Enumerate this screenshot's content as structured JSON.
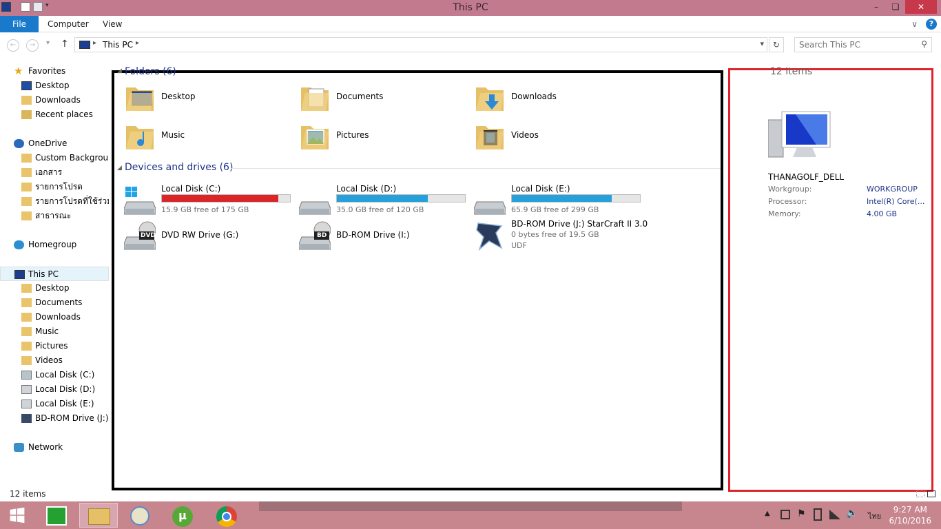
{
  "window": {
    "title": "This PC",
    "minimize": "–",
    "maximize": "❏",
    "close": "✕"
  },
  "ribbon": {
    "file": "File",
    "tabs": [
      "Computer",
      "View"
    ],
    "expand": "∨",
    "help": "?"
  },
  "address": {
    "back": "←",
    "forward": "→",
    "dropdown": "▾",
    "up": "↑",
    "path": "This PC",
    "path_arrow": "▸",
    "history": "▾",
    "refresh": "↻",
    "search_placeholder": "Search This PC",
    "search_icon": "⚲"
  },
  "nav": {
    "favorites": {
      "label": "Favorites",
      "items": [
        "Desktop",
        "Downloads",
        "Recent places"
      ]
    },
    "onedrive": {
      "label": "OneDrive",
      "items": [
        "Custom Backgroun",
        "เอกสาร",
        "รายการโปรด",
        "รายการโปรดที่ใช้ร่วมกัน",
        "สาธารณะ"
      ]
    },
    "homegroup": "Homegroup",
    "thispc": {
      "label": "This PC",
      "items": [
        "Desktop",
        "Documents",
        "Downloads",
        "Music",
        "Pictures",
        "Videos",
        "Local Disk (C:)",
        "Local Disk (D:)",
        "Local Disk (E:)",
        "BD-ROM Drive (J:) St"
      ]
    },
    "network": "Network"
  },
  "folders": {
    "header": "Folders (6)",
    "collapse": "◢",
    "items": [
      "Desktop",
      "Documents",
      "Downloads",
      "Music",
      "Pictures",
      "Videos"
    ]
  },
  "devices": {
    "header": "Devices and drives (6)",
    "collapse": "◢",
    "items": [
      {
        "name": "Local Disk (C:)",
        "free": "15.9 GB free of 175 GB",
        "used_fraction": 0.91,
        "color": "#da2626"
      },
      {
        "name": "Local Disk (D:)",
        "free": "35.0 GB free of 120 GB",
        "used_fraction": 0.71,
        "color": "#26a0da"
      },
      {
        "name": "Local Disk (E:)",
        "free": "65.9 GB free of 299 GB",
        "used_fraction": 0.78,
        "color": "#26a0da"
      },
      {
        "name": "DVD RW Drive (G:)",
        "badge": "DVD"
      },
      {
        "name": "BD-ROM Drive (I:)",
        "badge": "BD"
      },
      {
        "name": "BD-ROM Drive (J:) StarCraft II 3.0",
        "free": "0 bytes free of 19.5 GB",
        "fs": "UDF"
      }
    ]
  },
  "details": {
    "count": "12 items",
    "computer": "THANAGOLF_DELL",
    "rows": [
      {
        "k": "Workgroup:",
        "v": "WORKGROUP"
      },
      {
        "k": "Processor:",
        "v": "Intel(R) Core(..."
      },
      {
        "k": "Memory:",
        "v": "4.00 GB"
      }
    ]
  },
  "status": {
    "text": "12 items"
  },
  "taskbar": {
    "icons": [
      "windows-start",
      "store",
      "file-explorer",
      "paint",
      "utorrent",
      "chrome"
    ],
    "ime": "ไทย",
    "time": "9:27 AM",
    "date": "6/10/2016"
  }
}
